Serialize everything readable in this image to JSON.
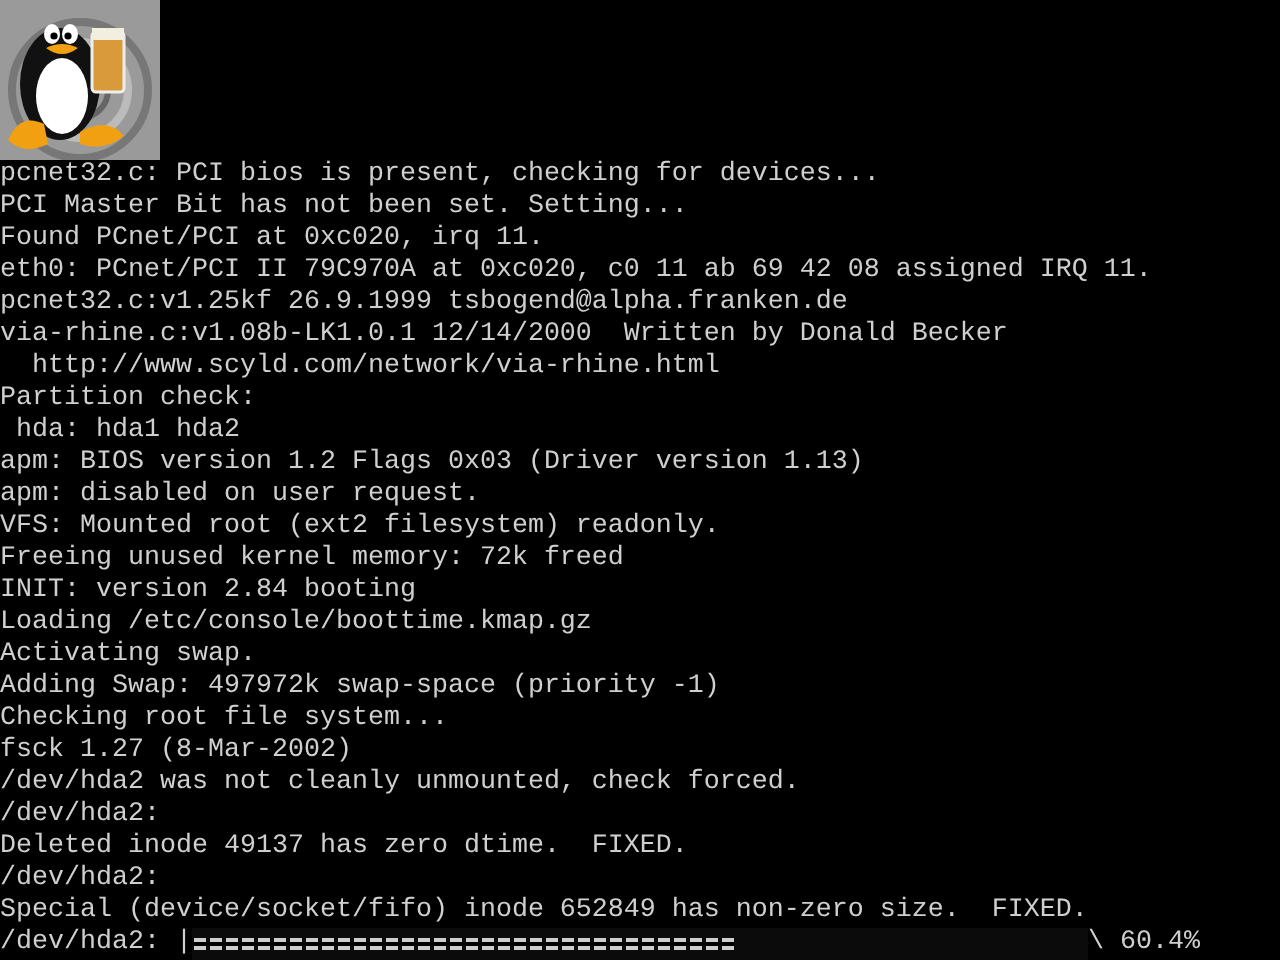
{
  "console": {
    "lines": [
      "pcnet32.c: PCI bios is present, checking for devices...",
      "PCI Master Bit has not been set. Setting...",
      "Found PCnet/PCI at 0xc020, irq 11.",
      "eth0: PCnet/PCI II 79C970A at 0xc020, c0 11 ab 69 42 08 assigned IRQ 11.",
      "pcnet32.c:v1.25kf 26.9.1999 tsbogend@alpha.franken.de",
      "via-rhine.c:v1.08b-LK1.0.1 12/14/2000  Written by Donald Becker",
      "  http://www.scyld.com/network/via-rhine.html",
      "Partition check:",
      " hda: hda1 hda2",
      "apm: BIOS version 1.2 Flags 0x03 (Driver version 1.13)",
      "apm: disabled on user request.",
      "VFS: Mounted root (ext2 filesystem) readonly.",
      "Freeing unused kernel memory: 72k freed",
      "INIT: version 2.84 booting",
      "Loading /etc/console/boottime.kmap.gz",
      "Activating swap.",
      "Adding Swap: 497972k swap-space (priority -1)",
      "Checking root file system...",
      "fsck 1.27 (8-Mar-2002)",
      "/dev/hda2 was not cleanly unmounted, check forced.",
      "/dev/hda2:",
      "Deleted inode 49137 has zero dtime.  FIXED.",
      "/dev/hda2:",
      "Special (device/socket/fifo) inode 652849 has non-zero size.  FIXED."
    ],
    "progress": {
      "label": "/dev/hda2: |",
      "level": 0.604,
      "spinner": "\\",
      "reading": "60.4%"
    }
  }
}
